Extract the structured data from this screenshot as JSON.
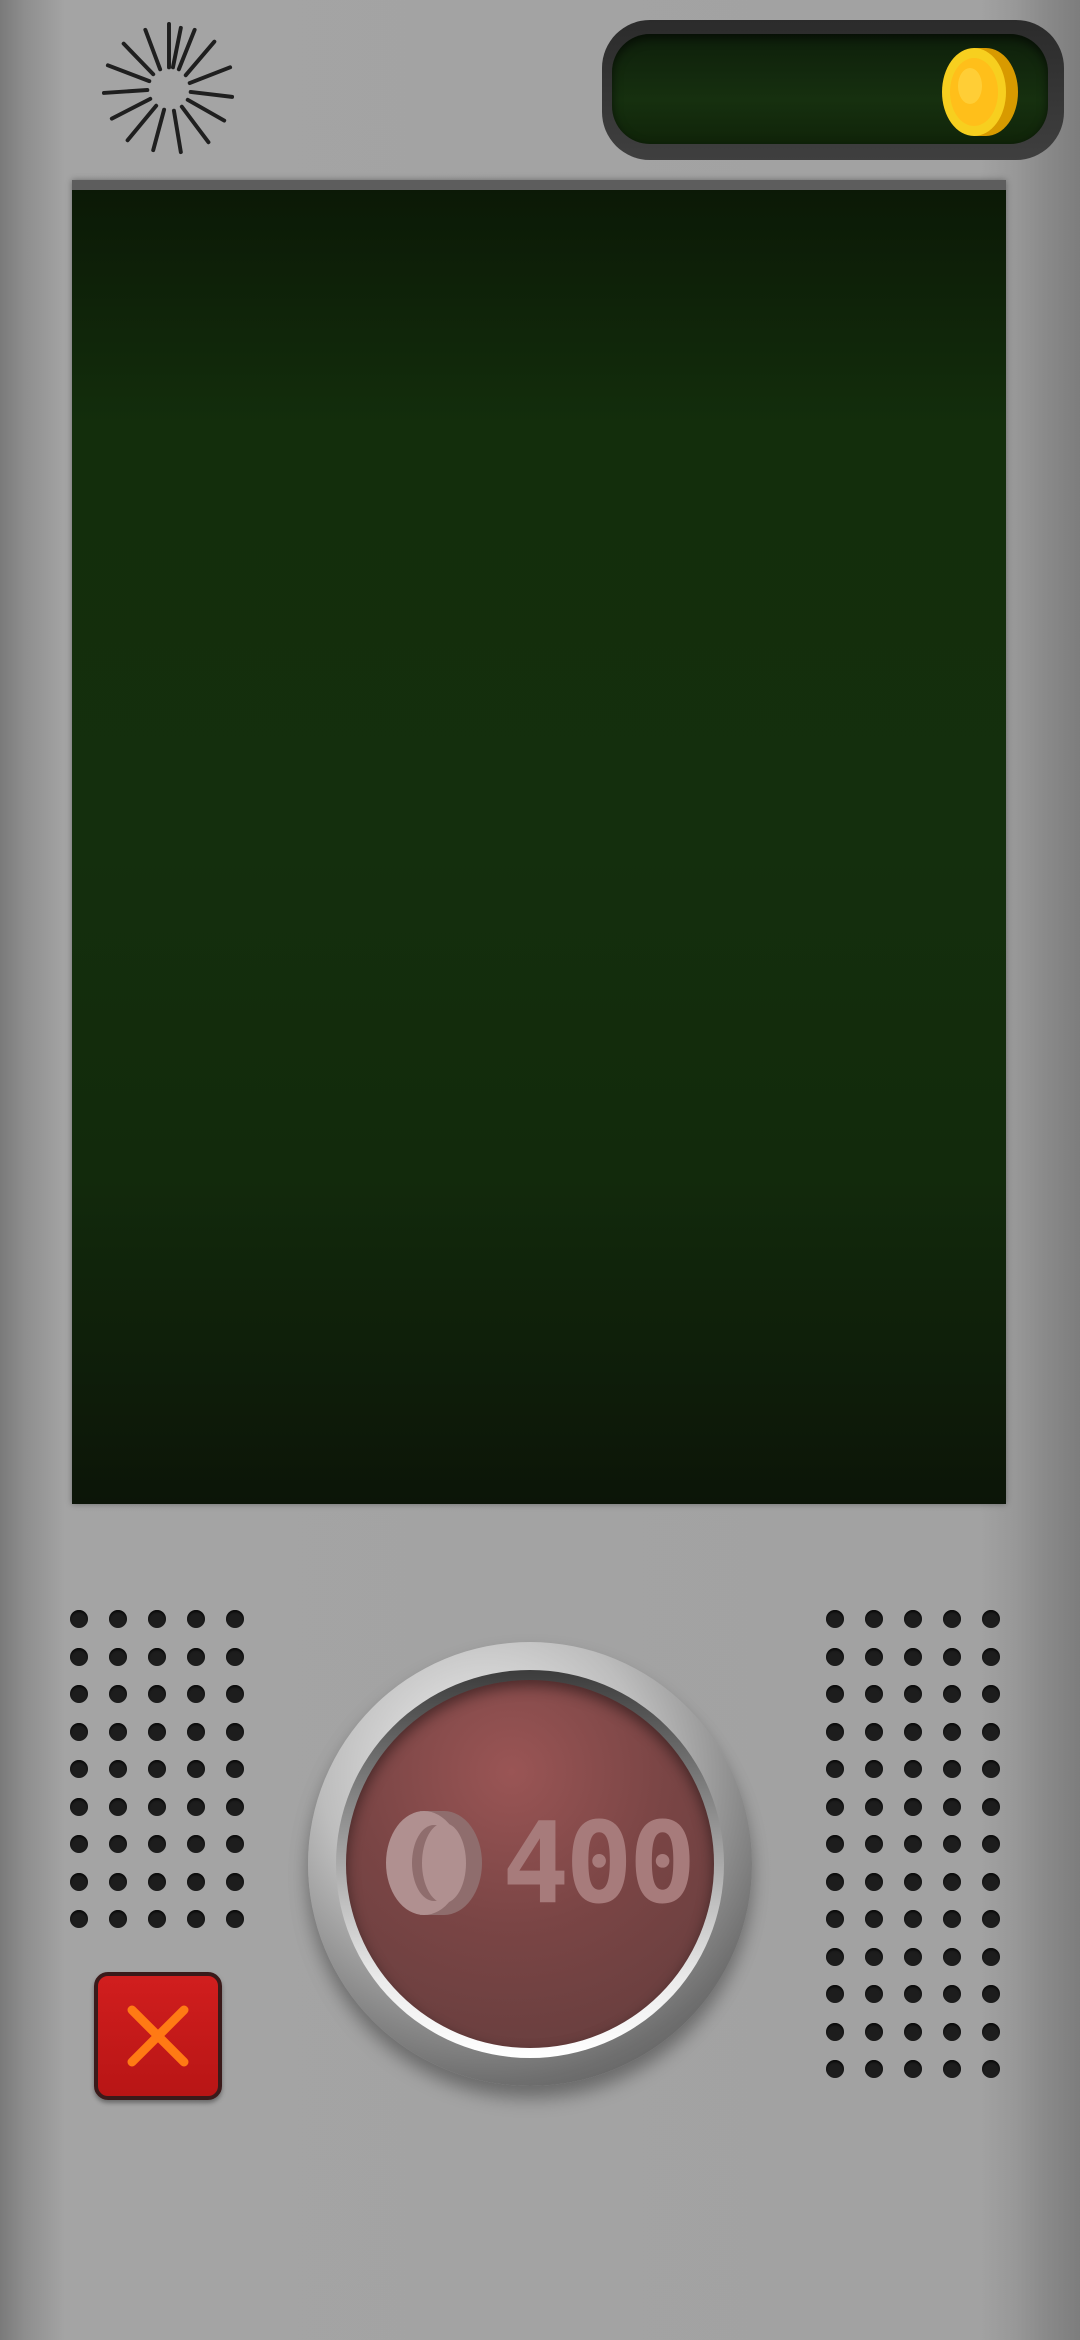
{
  "header": {
    "coin_display": {
      "value": "",
      "icon": "gold-coin-icon",
      "coin_color": "#f5c518"
    },
    "sunburst_icon": "sunburst-icon"
  },
  "screen": {
    "background_color": "#132e0c"
  },
  "controls": {
    "spin_button": {
      "price": "400",
      "icon": "coin-icon",
      "face_color": "#7a4545"
    },
    "close_button": {
      "icon": "close-x-icon",
      "color": "#d11e1e",
      "icon_color": "#ff7a14"
    }
  }
}
